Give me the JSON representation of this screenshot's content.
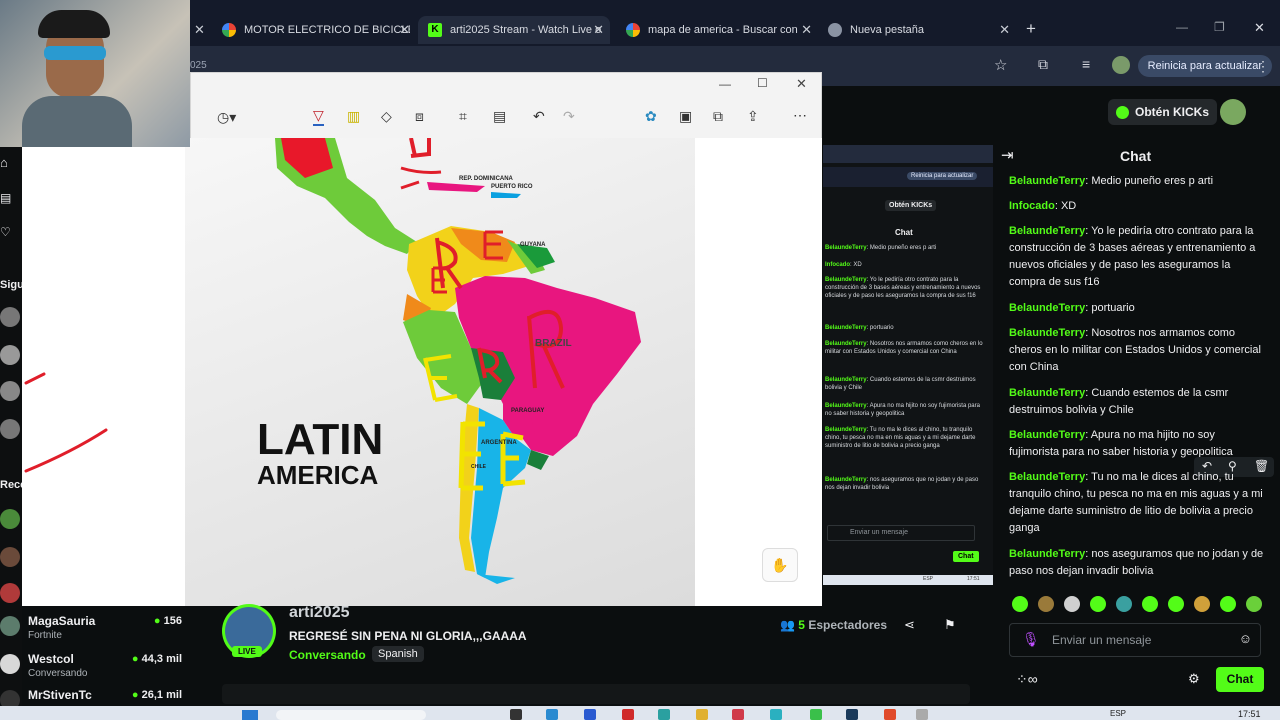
{
  "tabs": [
    {
      "label": "MOTOR ELECTRICO DE BICICLE",
      "icon": "google-icon"
    },
    {
      "label": "arti2025 Stream - Watch Live o",
      "icon": "kick-icon"
    },
    {
      "label": "mapa de america - Buscar con",
      "icon": "google-icon"
    },
    {
      "label": "Nueva pestaña",
      "icon": "chrome-icon"
    }
  ],
  "browser": {
    "update_label": "Reinicia para actualizar",
    "url_fragment": "025"
  },
  "header": {
    "kicks_label": "Obtén KICKs"
  },
  "chat": {
    "title": "Chat",
    "messages": [
      {
        "user": "BelaundeTerry",
        "text": ": Medio puneño eres p arti"
      },
      {
        "user": "Infocado",
        "text": ": XD"
      },
      {
        "user": "BelaundeTerry",
        "text": ": Yo le pediría otro contrato para la construcción de 3 bases aéreas y entrenamiento a nuevos oficiales y de paso les aseguramos la compra de sus f16"
      },
      {
        "user": "BelaundeTerry",
        "text": ": portuario"
      },
      {
        "user": "BelaundeTerry",
        "text": ": Nosotros nos armamos como cheros en lo militar con Estados Unidos y comercial con China"
      },
      {
        "user": "BelaundeTerry",
        "text": ": Cuando estemos de la csmr destruimos bolivia y Chile"
      },
      {
        "user": "BelaundeTerry",
        "text": ": Apura no ma hijito no soy fujimorista para no saber historia y geopolitica"
      },
      {
        "user": "BelaundeTerry",
        "text": ": Tu no ma le dices al chino, tu tranquilo chino, tu pesca no ma en mis aguas y a mi dejame darte suministro de litio de bolivia a precio ganga"
      },
      {
        "user": "BelaundeTerry",
        "text": ": nos aseguramos que no jodan y de paso nos dejan invadir bolivia"
      }
    ],
    "input_placeholder": "Enviar un mensaje",
    "send_label": "Chat"
  },
  "mini_chat": {
    "update_label": "Reinicia para actualizar",
    "kicks_label": "Obtén KICKs",
    "title": "Chat",
    "input_placeholder": "Enviar un mensaje",
    "send_label": "Chat",
    "clock": "17:51",
    "lang": "ESP"
  },
  "map": {
    "title_line1": "LATIN",
    "title_line2": "AMERICA",
    "labels": [
      "REP. DOMINICANA",
      "PUERTO RICO",
      "GUYANA",
      "BRAZIL",
      "PARAGUAY",
      "ARGENTINA",
      "CHILE"
    ]
  },
  "channel": {
    "name": "arti2025",
    "title": "REGRESÉ SIN PENA NI GLORIA,,,GAAAA",
    "category": "Conversando",
    "tag": "Spanish",
    "live_label": "LIVE",
    "viewers_count": "5",
    "viewers_label": "Espectadores"
  },
  "sidebar": {
    "following_label": "Sigu",
    "recommended_label": "Reco",
    "channels": [
      {
        "name": "MagaSauria",
        "category": "Fortnite",
        "viewers": "156"
      },
      {
        "name": "Westcol",
        "category": "Conversando",
        "viewers": "44,3 mil"
      },
      {
        "name": "MrStivenTc",
        "category": "",
        "viewers": "26,1 mil"
      }
    ]
  },
  "taskbar": {
    "lang": "ESP",
    "time": "17:51"
  },
  "colors": {
    "kick_green": "#53fc18",
    "bg": "#0b0e0f",
    "map_pink": "#e8167f"
  }
}
